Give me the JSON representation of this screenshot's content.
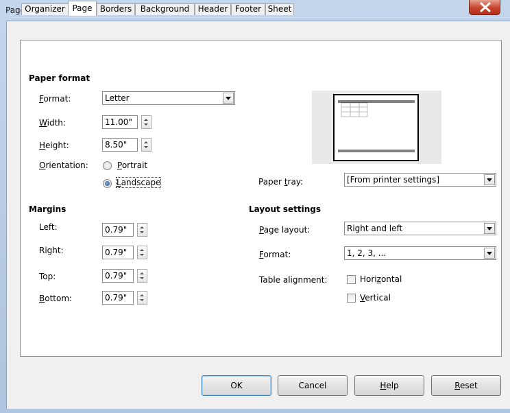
{
  "window": {
    "title": "Page Style: Default"
  },
  "tabs": [
    "Organizer",
    "Page",
    "Borders",
    "Background",
    "Header",
    "Footer",
    "Sheet"
  ],
  "paper_format": {
    "section": "Paper format",
    "format_label_u": "F",
    "format_label_rest": "ormat:",
    "format_value": "Letter",
    "width_label_u": "W",
    "width_label_rest": "idth:",
    "width_value": "11.00\"",
    "height_label_u": "H",
    "height_label_rest": "eight:",
    "height_value": "8.50\"",
    "orientation_label_u": "O",
    "orientation_label_rest": "rientation:",
    "portrait_u": "P",
    "portrait_rest": "ortrait",
    "landscape_u": "L",
    "landscape_rest": "andscape",
    "selected": "Landscape"
  },
  "paper_tray": {
    "label_pre": "Paper ",
    "label_u": "t",
    "label_rest": "ray:",
    "value": "[From printer settings]"
  },
  "margins": {
    "section": "Margins",
    "left_label": "Left:",
    "left_value": "0.79\"",
    "right_label": "Right:",
    "right_value": "0.79\"",
    "top_label": "Top:",
    "top_value": "0.79\"",
    "bottom_label_u": "B",
    "bottom_label_rest": "ottom:",
    "bottom_value": "0.79\""
  },
  "layout_settings": {
    "section": "Layout settings",
    "page_layout_u": "P",
    "page_layout_rest": "age layout:",
    "page_layout_value": "Right and left",
    "format_u": "F",
    "format_rest": "ormat:",
    "format_value": "1, 2, 3, ...",
    "table_alignment_label": "Table alignment:",
    "horizontal_pre": "Hori",
    "horizontal_u": "z",
    "horizontal_rest": "ontal",
    "vertical_u": "V",
    "vertical_rest": "ertical"
  },
  "buttons": {
    "ok": "OK",
    "cancel": "Cancel",
    "help_u": "H",
    "help_rest": "elp",
    "reset_u": "R",
    "reset_rest": "eset"
  },
  "icons": {
    "close": "close-x-icon",
    "dropdown": "chevron-down-icon",
    "spin": "spin-arrows-icon"
  }
}
